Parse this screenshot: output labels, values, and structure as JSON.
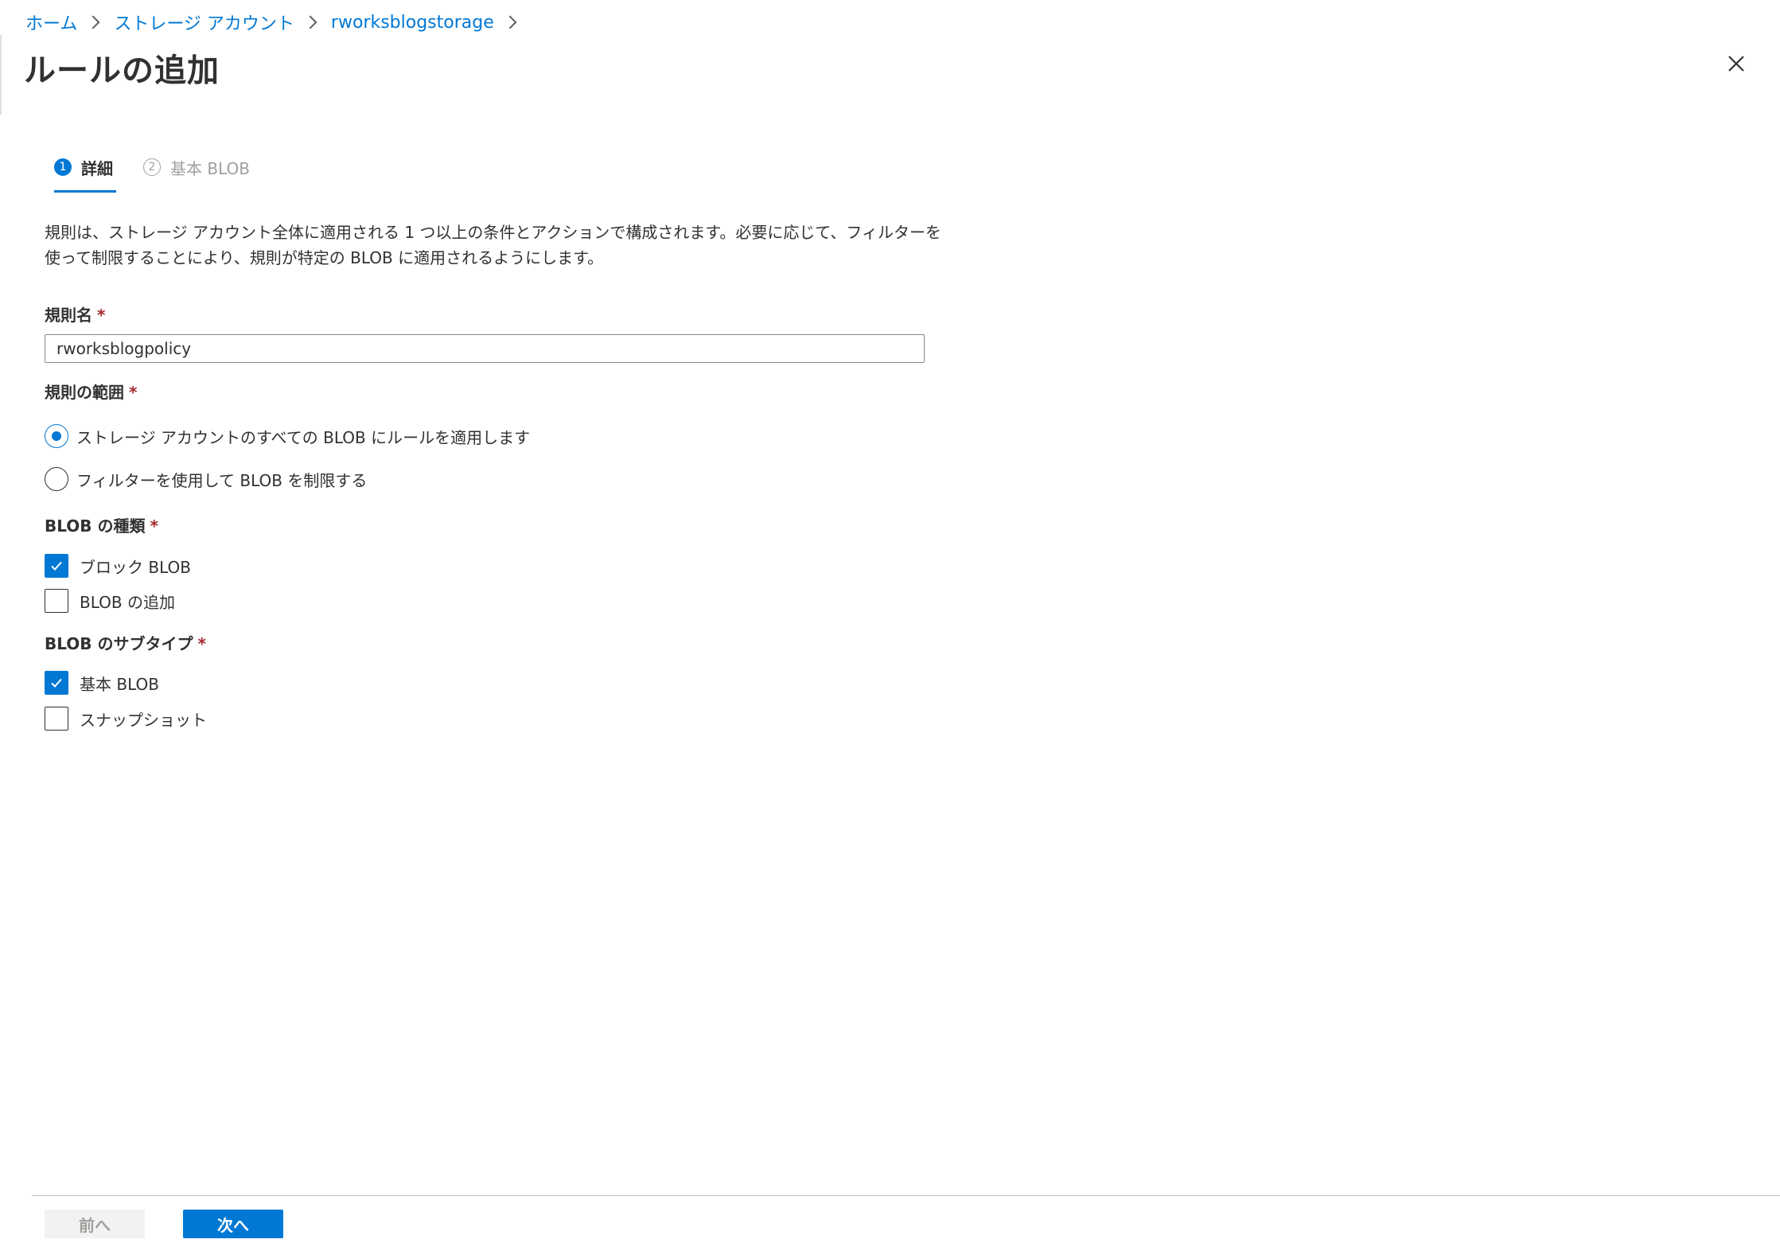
{
  "breadcrumb": {
    "items": [
      "ホーム",
      "ストレージ アカウント",
      "rworksblogstorage"
    ]
  },
  "page": {
    "title": "ルールの追加"
  },
  "tabs": [
    {
      "number": "1",
      "label": "詳細",
      "active": true
    },
    {
      "number": "2",
      "label": "基本 BLOB",
      "active": false
    }
  ],
  "description": "規則は、ストレージ アカウント全体に適用される 1 つ以上の条件とアクションで構成されます。必要に応じて、フィルターを使って制限することにより、規則が特定の BLOB に適用されるようにします。",
  "rule_name": {
    "label": "規則名",
    "required_mark": "*",
    "value": "rworksblogpolicy"
  },
  "rule_scope": {
    "label": "規則の範囲",
    "required_mark": "*",
    "options": [
      {
        "label": "ストレージ アカウントのすべての BLOB にルールを適用します",
        "selected": true
      },
      {
        "label": "フィルターを使用して BLOB を制限する",
        "selected": false
      }
    ]
  },
  "blob_type": {
    "label": "BLOB の種類",
    "required_mark": "*",
    "options": [
      {
        "label": "ブロック BLOB",
        "checked": true
      },
      {
        "label": "BLOB の追加",
        "checked": false
      }
    ]
  },
  "blob_subtype": {
    "label": "BLOB のサブタイプ",
    "required_mark": "*",
    "options": [
      {
        "label": "基本 BLOB",
        "checked": true
      },
      {
        "label": "スナップショット",
        "checked": false
      }
    ]
  },
  "footer": {
    "prev_label": "前へ",
    "next_label": "次へ"
  },
  "colors": {
    "accent": "#0078d4",
    "required": "#a4262c",
    "disabled_text": "#a19f9d"
  },
  "icons": {
    "close": "close-icon",
    "breadcrumb_separator": "chevron-right-icon",
    "check": "checkmark-icon"
  }
}
